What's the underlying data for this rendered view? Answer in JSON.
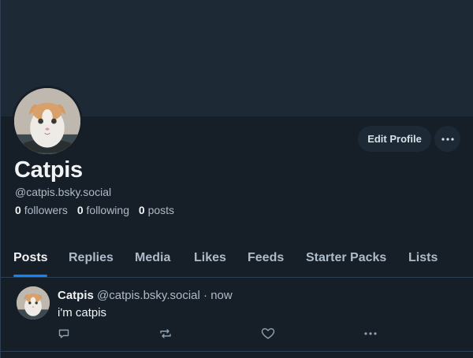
{
  "profile": {
    "display_name": "Catpis",
    "handle": "@catpis.bsky.social",
    "edit_label": "Edit Profile",
    "more_icon": "ellipsis-icon",
    "stats": {
      "followers_count": "0",
      "followers_label": "followers",
      "following_count": "0",
      "following_label": "following",
      "posts_count": "0",
      "posts_label": "posts"
    }
  },
  "tabs": [
    {
      "label": "Posts",
      "active": true
    },
    {
      "label": "Replies"
    },
    {
      "label": "Media"
    },
    {
      "label": "Likes"
    },
    {
      "label": "Feeds"
    },
    {
      "label": "Starter Packs"
    },
    {
      "label": "Lists"
    }
  ],
  "post": {
    "author_name": "Catpis",
    "author_handle": "@catpis.bsky.social",
    "separator": "·",
    "time": "now",
    "text": "i'm catpis",
    "actions": [
      "reply-icon",
      "repost-icon",
      "like-icon",
      "more-icon"
    ]
  },
  "colors": {
    "background": "#161e27",
    "banner": "#1e2936",
    "accent": "#1083fe",
    "text_primary": "#f1f3f5",
    "text_secondary": "#aebbc9"
  }
}
